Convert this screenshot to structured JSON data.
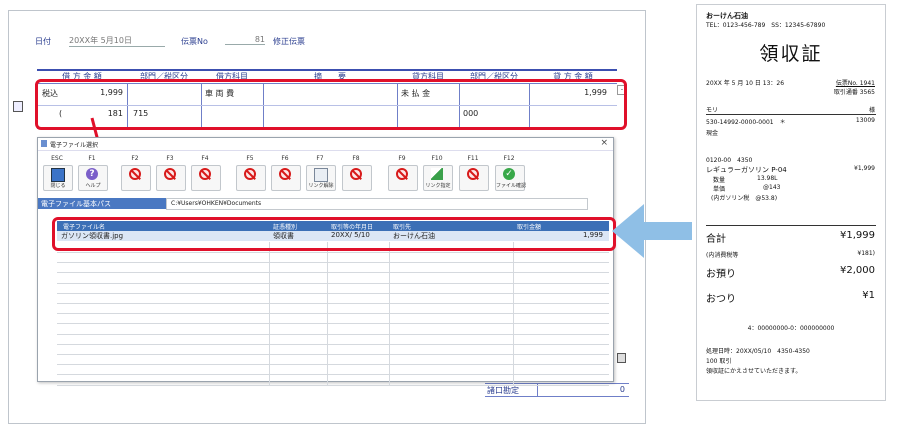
{
  "slip": {
    "date_label": "日付",
    "date_value": "20XX年 5月10日",
    "slipno_label": "伝票No",
    "slipno_value": "81",
    "mode_label": "修正伝票",
    "columns": [
      "借 方 金 額",
      "部門／税区分",
      "借方科目",
      "摘　　要",
      "貸方科目",
      "部門／税区分",
      "貸 方 金 額"
    ],
    "row1": {
      "tax_label": "税込",
      "debit_amount": "1,999",
      "debit_account": "車 両 費",
      "credit_account": "未 払 金",
      "credit_amount": "1,999"
    },
    "row2": {
      "paren": "(",
      "tax_amount": "181",
      "dept": "715",
      "credit_dept": "000"
    },
    "bottom_label": "諸口勘定",
    "bottom_value": "0"
  },
  "dialog": {
    "title": "電子ファイル選択",
    "close": "×",
    "fkeys": [
      {
        "key": "ESC",
        "icon": "exit-icon",
        "caption": "閉じる"
      },
      {
        "key": "F1",
        "icon": "help-icon",
        "caption": "ヘルプ"
      },
      {
        "key": "F2",
        "icon": "disabled-icon",
        "caption": ""
      },
      {
        "key": "F3",
        "icon": "disabled-icon",
        "caption": ""
      },
      {
        "key": "F4",
        "icon": "disabled-icon",
        "caption": ""
      },
      {
        "key": "F5",
        "icon": "disabled-icon",
        "caption": ""
      },
      {
        "key": "F6",
        "icon": "disabled-icon",
        "caption": ""
      },
      {
        "key": "F7",
        "icon": "unlink-icon",
        "caption": "リンク解除"
      },
      {
        "key": "F8",
        "icon": "disabled-icon",
        "caption": ""
      },
      {
        "key": "F9",
        "icon": "disabled-icon",
        "caption": ""
      },
      {
        "key": "F10",
        "icon": "link-icon",
        "caption": "リンク指定"
      },
      {
        "key": "F11",
        "icon": "disabled-icon",
        "caption": ""
      },
      {
        "key": "F12",
        "icon": "check-icon",
        "caption": "ファイル確認"
      }
    ],
    "path_label": "電子ファイル基本パス",
    "path_value": "C:¥Users¥OHKEN¥Documents",
    "table_headers": [
      "電子ファイル名",
      "証憑種別",
      "取引等の年月日",
      "取引先",
      "取引金額"
    ],
    "table_row": [
      "ガソリン領収書.jpg",
      "領収書",
      "20XX/ 5/10",
      "おーけん石油",
      "1,999"
    ]
  },
  "receipt": {
    "shop": "おーけん石油",
    "tel": "TEL：0123-456-789　SS：12345-67890",
    "title": "領収証",
    "datetime": "20XX 年 5 月 10 日 13：26",
    "slip_no": "伝票No. 1941",
    "txn": "取引通番 3565",
    "name": "モリ",
    "honorific": "様",
    "card": "530-14992-0000-0001　＊",
    "card_no": "13009",
    "payment": "現金",
    "code": "0120-00　4350",
    "product": "レギュラーガソリン P-04",
    "product_amount": "¥1,999",
    "qty_label": "数量",
    "qty": "13.98L",
    "unit_label": "単価",
    "unit": "@143",
    "gas_tax": "(内ガソリン税　@53.8)",
    "total_label": "合計",
    "total": "¥1,999",
    "tax_label": "(内消費税等",
    "tax": "¥181)",
    "received_label": "お預り",
    "received": "¥2,000",
    "change_label": "おつり",
    "change": "¥1",
    "terminal": "4：00000000-0：000000000",
    "processed": "処理日時：20XX/05/10　4350-4350",
    "count": "100 取引",
    "note": "領収証にかえさせていただきます。"
  },
  "colors": {
    "accent_blue": "#2a3d8f",
    "highlight_red": "#e0102a",
    "arrow_blue": "#8fbfe6",
    "table_header": "#3b6fb6"
  }
}
